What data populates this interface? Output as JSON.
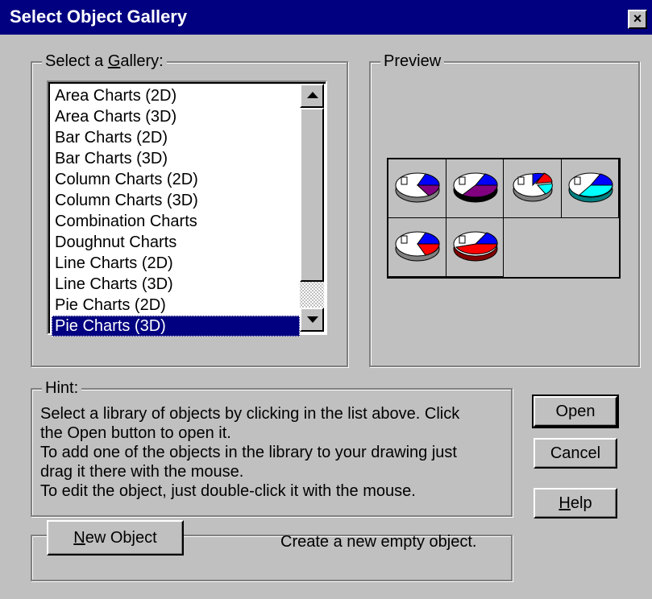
{
  "window": {
    "title": "Select Object Gallery",
    "close_label": "×"
  },
  "gallery": {
    "legend_pre": "Select a ",
    "legend_key": "G",
    "legend_post": "allery:",
    "items": [
      "Area Charts (2D)",
      "Area Charts (3D)",
      "Bar Charts (2D)",
      "Bar Charts (3D)",
      "Column Charts (2D)",
      "Column Charts (3D)",
      "Combination Charts",
      "Doughnut Charts",
      "Line Charts (2D)",
      "Line Charts (3D)",
      "Pie Charts (2D)",
      "Pie Charts (3D)"
    ],
    "selected": "Pie Charts (3D)"
  },
  "preview": {
    "legend": "Preview",
    "thumbnails": [
      "pie-3d-purple",
      "pie-3d-dark-purple",
      "pie-3d-cyan-red",
      "pie-3d-cyan",
      "pie-3d-red-blue",
      "pie-3d-red"
    ]
  },
  "hint": {
    "legend": "Hint:",
    "lines": [
      "Select a library of objects by clicking in the list above. Click",
      "the Open button to open it.",
      "To add one of the objects in the library to your drawing just",
      "drag it there with the mouse.",
      "To edit the object, just double-click it with the mouse."
    ]
  },
  "buttons": {
    "open": "Open",
    "cancel": "Cancel",
    "help_key": "H",
    "help_rest": "elp",
    "new_key": "N",
    "new_rest": "ew Object"
  },
  "new_object": {
    "description": "Create a new empty object."
  },
  "colors": {
    "title_bar": "#000080",
    "face": "#c0c0c0",
    "selection": "#000080"
  }
}
